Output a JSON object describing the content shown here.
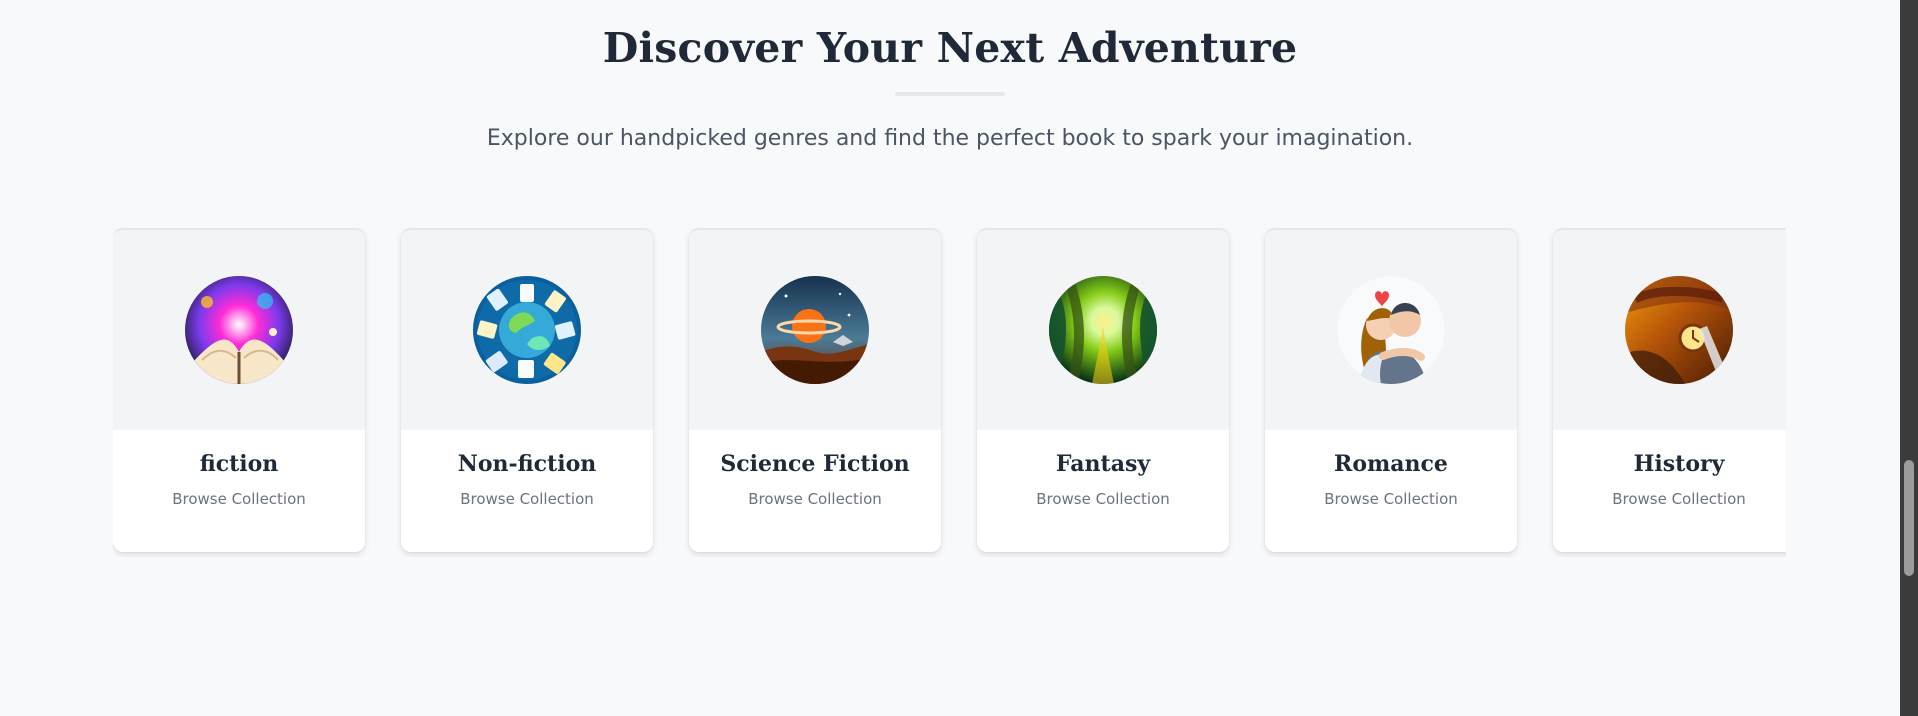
{
  "section": {
    "title": "Discover Your Next Adventure",
    "subtitle": "Explore our handpicked genres and find the perfect book to spark your imagination."
  },
  "genres": [
    {
      "name": "fiction",
      "link_label": "Browse Collection",
      "image_icon": "fiction-book-burst-icon",
      "colors": [
        "#ff2bd6",
        "#7c3aed",
        "#fbbf24"
      ]
    },
    {
      "name": "Non-fiction",
      "link_label": "Browse Collection",
      "image_icon": "globe-books-icon",
      "colors": [
        "#0b5f9c",
        "#35a9d8",
        "#7ed957"
      ]
    },
    {
      "name": "Science Fiction",
      "link_label": "Browse Collection",
      "image_icon": "space-planet-icon",
      "colors": [
        "#16324f",
        "#f97316",
        "#78350f"
      ]
    },
    {
      "name": "Fantasy",
      "link_label": "Browse Collection",
      "image_icon": "enchanted-forest-icon",
      "colors": [
        "#14532d",
        "#84cc16",
        "#fef08a"
      ]
    },
    {
      "name": "Romance",
      "link_label": "Browse Collection",
      "image_icon": "couple-kissing-icon",
      "colors": [
        "#f8fafc",
        "#ef4444",
        "#64748b"
      ]
    },
    {
      "name": "History",
      "link_label": "Browse Collection",
      "image_icon": "history-book-icon",
      "colors": [
        "#7c2d12",
        "#b45309",
        "#fde68a"
      ]
    }
  ],
  "theme": {
    "background": "#f8f9fb",
    "card_background": "#ffffff",
    "image_background": "#f3f4f6",
    "heading_color": "#1f2937",
    "muted_text": "#6b7280"
  }
}
